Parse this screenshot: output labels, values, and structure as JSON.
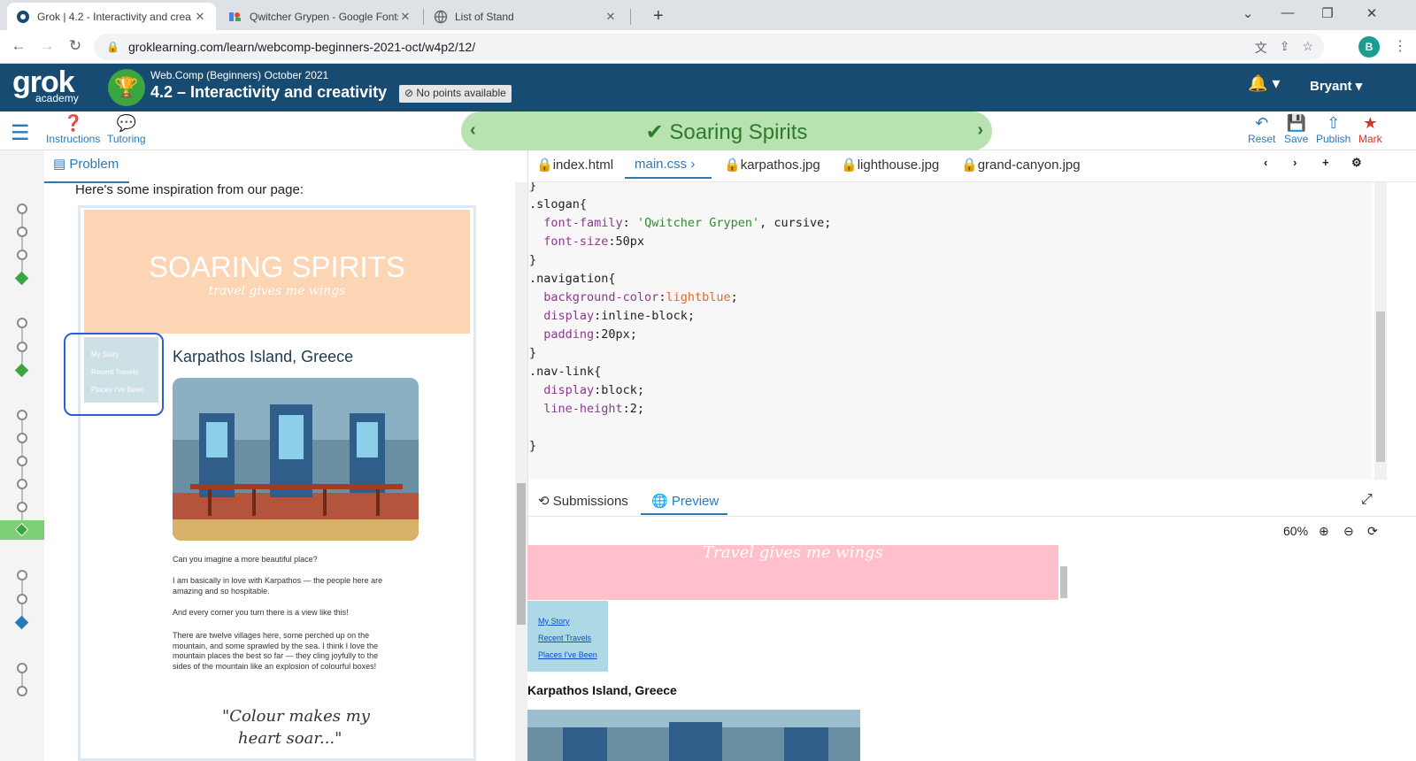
{
  "browser": {
    "tabs": [
      {
        "title": "Grok | 4.2 - Interactivity and crea"
      },
      {
        "title": "Qwitcher Grypen - Google Fonts"
      },
      {
        "title": "List of Stand"
      }
    ],
    "url": "groklearning.com/learn/webcomp-beginners-2021-oct/w4p2/12/",
    "profile_initial": "B"
  },
  "header": {
    "logo": "grok",
    "logo_sub": "academy",
    "course": "Web.Comp (Beginners) October 2021",
    "unit": "4.2 – Interactivity and creativity",
    "points": "No points available",
    "user": "Bryant"
  },
  "toolbar": {
    "instructions": "Instructions",
    "tutoring": "Tutoring",
    "banner_title": "Soaring Spirits",
    "reset": "Reset",
    "save": "Save",
    "publish": "Publish",
    "mark": "Mark"
  },
  "problem": {
    "tab": "Problem",
    "intro": "Here's some inspiration from our page:",
    "mock": {
      "title": "SOARING SPIRITS",
      "slogan": "travel gives me wings",
      "nav": [
        "My Story",
        "Recent Travels",
        "Places I've Been"
      ],
      "heading": "Karpathos Island, Greece",
      "paragraphs": [
        "Can you imagine a more beautiful place?",
        "I am basically in love with Karpathos — the people here are amazing and so hospitable.",
        "And every corner you turn there is a view like this!",
        "There are twelve villages here, some perched up on the mountain, and some sprawled by the sea. I think I love the mountain places the best so far — they cling joyfully to the sides of the mountain like an explosion of colourful boxes!"
      ],
      "quote_line1": "\"Colour makes my",
      "quote_line2": "heart soar...\""
    }
  },
  "editor": {
    "tabs": [
      "index.html",
      "main.css",
      "karpathos.jpg",
      "lighthouse.jpg",
      "grand-canyon.jpg"
    ],
    "active_tab": "main.css",
    "code": {
      "l0": "}",
      "l1_sel": ".slogan{",
      "l2_prop": "font-family",
      "l2_str": "'Qwitcher Grypen'",
      "l2_rest": ", cursive;",
      "l3_prop": "font-size",
      "l3_val": ":50px",
      "l4": "}",
      "l5_sel": ".navigation{",
      "l6_prop": "background-color",
      "l6_kw": "lightblue",
      "l7_prop": "display",
      "l7_val": ":inline-block;",
      "l8_prop": "padding",
      "l8_val": ":20px;",
      "l9": "}",
      "l10_sel": ".nav-link{",
      "l11_prop": "display",
      "l11_val": ":block;",
      "l12_prop": "line-height",
      "l12_val": ":2;",
      "l14": "}"
    }
  },
  "preview": {
    "tabs": [
      "Submissions",
      "Preview"
    ],
    "active_tab": "Preview",
    "zoom": "60%",
    "slogan": "Travel gives me wings",
    "nav": [
      "My Story",
      "Recent Travels",
      "Places I've Been"
    ],
    "heading": "Karpathos Island, Greece"
  }
}
